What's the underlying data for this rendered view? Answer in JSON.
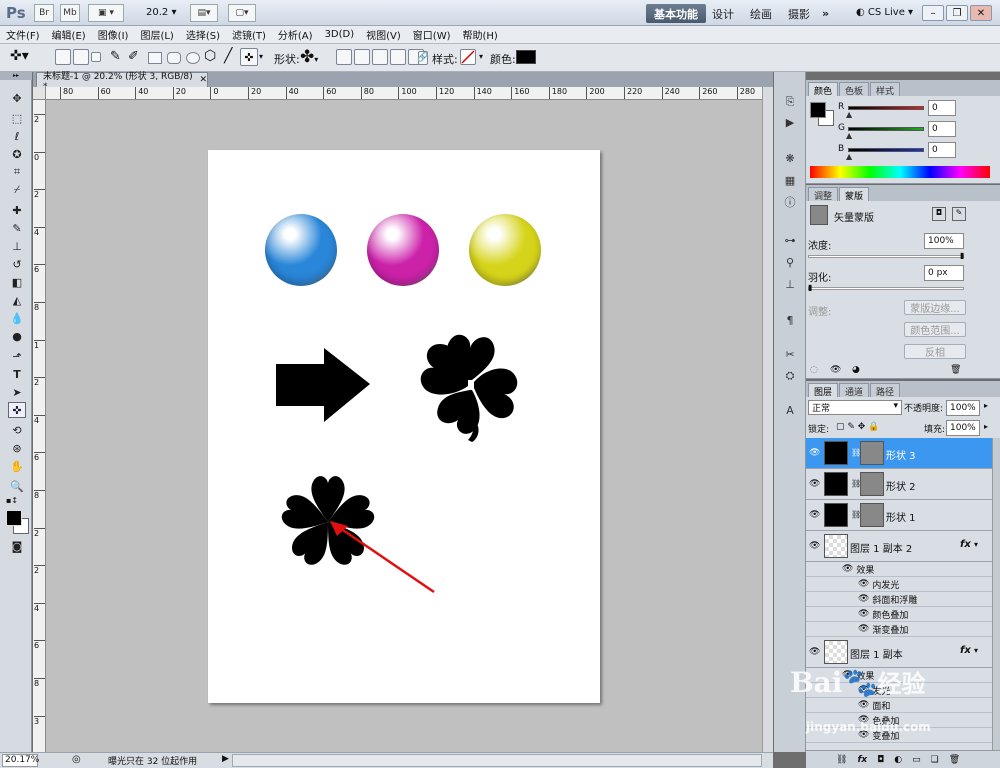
{
  "app": {
    "logo": "Ps",
    "titlebar_buttons": [
      "Br",
      "Mb"
    ],
    "zoom_menu": "20.2",
    "workspaces": [
      "基本功能",
      "设计",
      "绘画",
      "摄影",
      "»"
    ],
    "cslive": "CS Live"
  },
  "menu": [
    "文件(F)",
    "编辑(E)",
    "图像(I)",
    "图层(L)",
    "选择(S)",
    "滤镜(T)",
    "分析(A)",
    "3D(D)",
    "视图(V)",
    "窗口(W)",
    "帮助(H)"
  ],
  "options": {
    "shape_label": "形状:",
    "style_label": "样式:",
    "color_label": "颜色:",
    "color_value": "#000000"
  },
  "document": {
    "tab_title": "未标题-1 @ 20.2% (形状 3, RGB/8) *",
    "ruler_h": [
      "80",
      "60",
      "40",
      "20",
      "0",
      "20",
      "40",
      "60",
      "80",
      "100",
      "120",
      "140",
      "160",
      "180",
      "200",
      "220",
      "240",
      "260",
      "280"
    ],
    "ruler_v": [
      "2",
      "0",
      "2",
      "4",
      "6",
      "8",
      "1",
      "2",
      "4",
      "6",
      "8",
      "2",
      "2",
      "4",
      "6",
      "8",
      "3"
    ],
    "balls": [
      "#2a86d8",
      "#cc22aa",
      "#d6d41a"
    ],
    "arrow_color": "#e01010"
  },
  "status": {
    "zoom": "20.17%",
    "message": "曝光只在 32 位起作用"
  },
  "color_panel": {
    "tabs": [
      "颜色",
      "色板",
      "样式"
    ],
    "channels": [
      {
        "label": "R",
        "value": "0",
        "color": "#e02020"
      },
      {
        "label": "G",
        "value": "0",
        "color": "#20b020"
      },
      {
        "label": "B",
        "value": "0",
        "color": "#2030d0"
      }
    ]
  },
  "mask_panel": {
    "tabs": [
      "调整",
      "蒙版"
    ],
    "title": "矢量蒙版",
    "density_label": "浓度:",
    "density_value": "100%",
    "feather_label": "羽化:",
    "feather_value": "0 px",
    "adjust_label": "调整:",
    "btn_edge": "蒙版边缘...",
    "btn_range": "颜色范围...",
    "btn_invert": "反相"
  },
  "layers_panel": {
    "tabs": [
      "图层",
      "通道",
      "路径"
    ],
    "blend_mode": "正常",
    "opacity_label": "不透明度:",
    "opacity_value": "100%",
    "lock_label": "锁定:",
    "fill_label": "填充:",
    "fill_value": "100%",
    "layers": [
      {
        "name": "形状 3",
        "selected": true
      },
      {
        "name": "形状 2",
        "selected": false
      },
      {
        "name": "形状 1",
        "selected": false
      },
      {
        "name": "图层 1 副本 2",
        "fx": "fx"
      },
      {
        "name": "图层 1 副本",
        "fx": "fx"
      }
    ],
    "effects_label": "效果",
    "effects": [
      "内发光",
      "斜面和浮雕",
      "颜色叠加",
      "渐变叠加"
    ],
    "effects_partial": [
      "效果",
      "发光",
      "面和",
      "色叠加",
      "变叠加"
    ]
  },
  "watermark": {
    "brand": "Bai",
    "cn": "经验",
    "url": "jingyan.baidu.com"
  }
}
